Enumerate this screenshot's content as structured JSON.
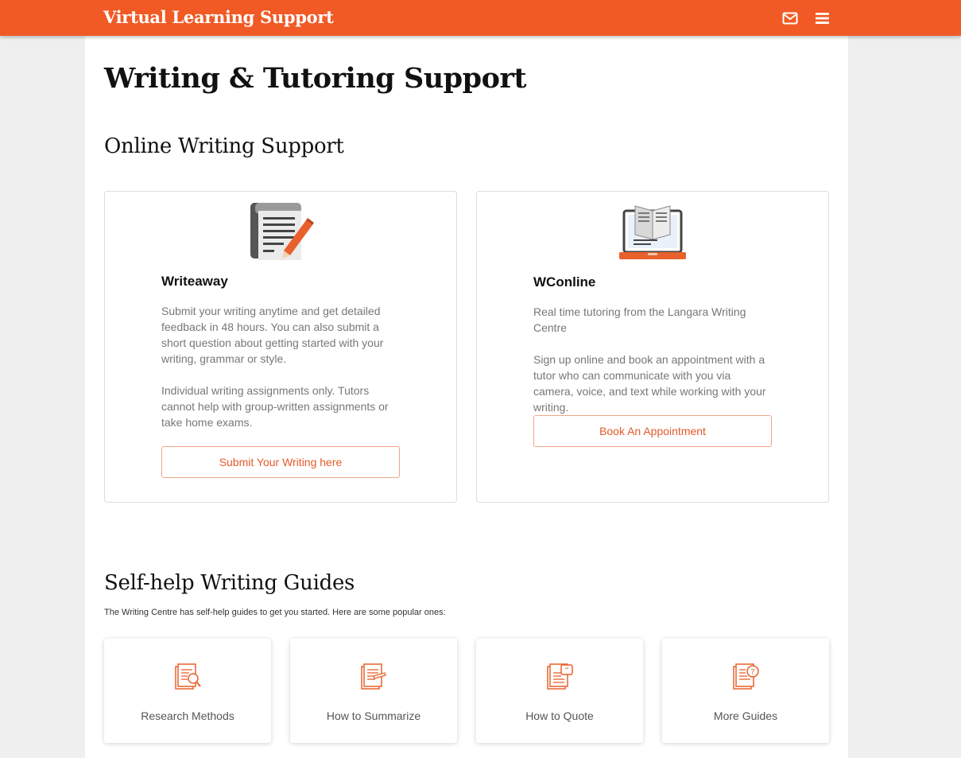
{
  "header": {
    "brand": "Virtual Learning Support",
    "icons": [
      "envelope-icon",
      "hamburger-menu-icon"
    ],
    "color": "#f15a24"
  },
  "page": {
    "title": "Writing & Tutoring Support"
  },
  "online": {
    "heading": "Online Writing Support",
    "cards": [
      {
        "title": "Writeaway",
        "icon": "notebook-pencil-icon",
        "paragraphs": [
          "Submit your writing anytime and get detailed feedback in 48 hours. You can also submit a short question about getting started with your writing, grammar or style.",
          "Individual writing assignments only. Tutors cannot help with group-written assignments or take home exams."
        ],
        "button": "Submit Your Writing here"
      },
      {
        "title": "WConline",
        "icon": "laptop-book-icon",
        "paragraphs": [
          "Real time tutoring from the Langara Writing Centre",
          "Sign up online and book an appointment with a tutor who can communicate with you via camera, voice, and text while working with your writing."
        ],
        "button": "Book An Appointment"
      }
    ]
  },
  "guides": {
    "heading": "Self-help Writing Guides",
    "intro": "The Writing Centre has self-help guides to get you started. Here are some popular ones:",
    "items": [
      {
        "label": "Research Methods",
        "icon": "document-magnifier-icon"
      },
      {
        "label": "How to Summarize",
        "icon": "document-pencil-icon"
      },
      {
        "label": "How to Quote",
        "icon": "document-quote-icon"
      },
      {
        "label": "More Guides",
        "icon": "document-question-icon"
      }
    ]
  },
  "colors": {
    "accent": "#f15a24",
    "button_text": "#e35a2c",
    "button_border": "#f0a58a"
  }
}
